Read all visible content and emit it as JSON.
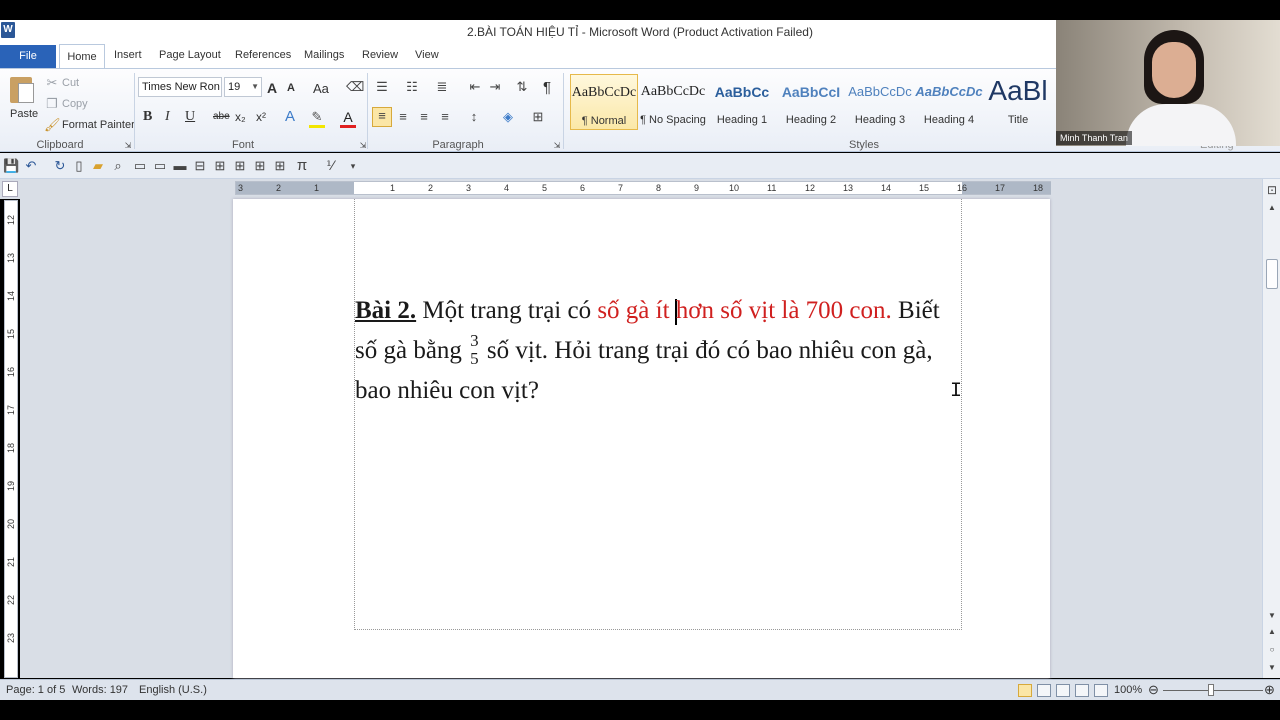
{
  "window": {
    "title": "2.BÀI TOÁN HIỆU TỈ - Microsoft Word (Product Activation Failed)",
    "app_icon": "W"
  },
  "tabs": {
    "file": "File",
    "home": "Home",
    "insert": "Insert",
    "page_layout": "Page Layout",
    "references": "References",
    "mailings": "Mailings",
    "review": "Review",
    "view": "View"
  },
  "clipboard": {
    "paste": "Paste",
    "cut": "Cut",
    "copy": "Copy",
    "format_painter": "Format Painter",
    "label": "Clipboard"
  },
  "font": {
    "name": "Times New Ron",
    "size": "19",
    "label": "Font",
    "bold": "B",
    "italic": "I",
    "underline": "U",
    "strike": "abe",
    "subscript": "x₂",
    "superscript": "x²",
    "grow": "A",
    "shrink": "A",
    "case": "Aa"
  },
  "paragraph": {
    "label": "Paragraph",
    "pilcrow": "¶"
  },
  "styles": {
    "label": "Styles",
    "items": [
      {
        "sample": "AaBbCcDc",
        "name": "¶ Normal"
      },
      {
        "sample": "AaBbCcDc",
        "name": "¶ No Spacing"
      },
      {
        "sample": "AaBbCc",
        "name": "Heading 1"
      },
      {
        "sample": "AaBbCcI",
        "name": "Heading 2"
      },
      {
        "sample": "AaBbCcDc",
        "name": "Heading 3"
      },
      {
        "sample": "AaBbCcDc",
        "name": "Heading 4"
      },
      {
        "sample": "AaBl",
        "name": "Title"
      }
    ],
    "editing_label": "Editing"
  },
  "ruler": {
    "h_numbers": [
      "3",
      "2",
      "1",
      "1",
      "2",
      "3",
      "4",
      "5",
      "6",
      "7",
      "8",
      "9",
      "10",
      "11",
      "12",
      "13",
      "14",
      "15",
      "16",
      "17",
      "18"
    ],
    "v_numbers": [
      "12",
      "13",
      "14",
      "15",
      "16",
      "17",
      "18",
      "19",
      "20",
      "21",
      "22",
      "23"
    ]
  },
  "document": {
    "heading": "Bài 2.",
    "seg1": " Một trang trại có ",
    "red1": "số gà ít ",
    "red2": "hơn số vịt là 700 con.",
    "seg2": " Biết",
    "seg3": "số gà bằng ",
    "frac_num": "3",
    "frac_den": "5",
    "seg4": " số vịt. Hỏi trang trại đó có bao nhiêu con gà,",
    "seg5": "bao nhiêu con vịt?",
    "red_color": "#d0201f"
  },
  "status": {
    "page": "Page: 1 of 5",
    "words": "Words: 197",
    "language": "English (U.S.)",
    "zoom": "100%",
    "zoom_level": 1.0
  },
  "webcam": {
    "name": "Minh Thanh Tran"
  }
}
